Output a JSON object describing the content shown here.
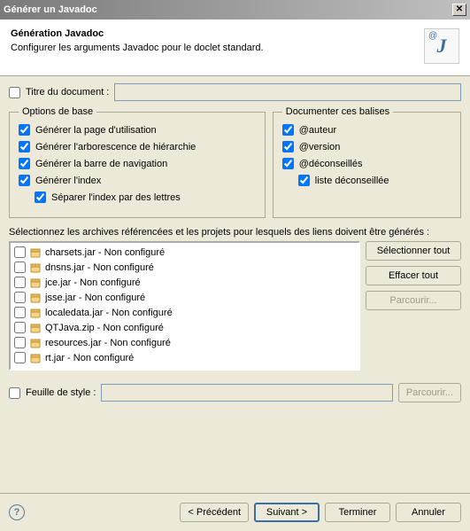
{
  "window": {
    "title": "Générer un Javadoc"
  },
  "header": {
    "title": "Génération Javadoc",
    "subtitle": "Configurer les arguments Javadoc pour le doclet standard."
  },
  "doc_title": {
    "label": "Titre du document :",
    "value": ""
  },
  "options": {
    "legend": "Options de base",
    "usage": "Générer la page d'utilisation",
    "hierarchy": "Générer l'arborescence de hiérarchie",
    "navbar": "Générer la barre de navigation",
    "index": "Générer l'index",
    "split_index": "Séparer l'index par des lettres"
  },
  "tags": {
    "legend": "Documenter ces balises",
    "author": "@auteur",
    "version": "@version",
    "deprecated": "@déconseillés",
    "deprecated_list": "liste déconseillée"
  },
  "archives": {
    "label": "Sélectionnez les archives référencées et les projets pour lesquels des liens doivent être générés :",
    "items": [
      "charsets.jar - Non configuré",
      "dnsns.jar - Non configuré",
      "jce.jar - Non configuré",
      "jsse.jar - Non configuré",
      "localedata.jar - Non configuré",
      "QTJava.zip - Non configuré",
      "resources.jar - Non configuré",
      "rt.jar - Non configuré"
    ],
    "select_all": "Sélectionner tout",
    "clear_all": "Effacer tout",
    "browse": "Parcourir..."
  },
  "stylesheet": {
    "label": "Feuille de style :",
    "browse": "Parcourir...",
    "value": ""
  },
  "footer": {
    "back": "< Précédent",
    "next": "Suivant >",
    "finish": "Terminer",
    "cancel": "Annuler"
  }
}
